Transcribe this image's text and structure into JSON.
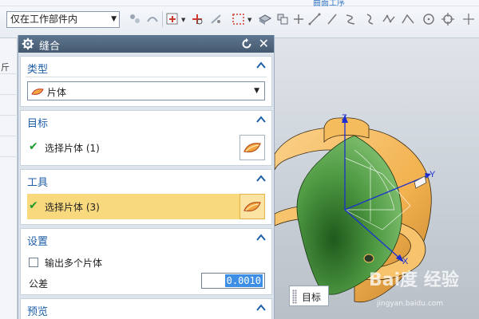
{
  "toolbar": {
    "ribbon_label": "曲面工序",
    "filter_value": "仅在工作部件内"
  },
  "left_strip": {
    "letter": "斤"
  },
  "dialog": {
    "title": "缝合",
    "groups": {
      "type": {
        "title": "类型",
        "select_value": "片体"
      },
      "target": {
        "title": "目标",
        "selection": "选择片体 (1)"
      },
      "tool": {
        "title": "工具",
        "selection": "选择片体 (3)"
      },
      "settings": {
        "title": "设置",
        "output_multiple_label": "输出多个片体",
        "output_multiple_checked": false,
        "tolerance_label": "公差",
        "tolerance_value": "0.0010"
      },
      "preview": {
        "title": "预览"
      }
    }
  },
  "viewport": {
    "tooltip": "目标",
    "axis_labels": {
      "z": "Z",
      "y": "Y",
      "x": "X"
    },
    "watermark": "Bai度 经验",
    "watermark_url": "jingyan.baidu.com"
  },
  "colors": {
    "title_bar": "#4f667d",
    "group_title": "#1f5fa8",
    "active_row": "#f9d97d",
    "surface_orange": "#f2b24f",
    "surface_green": "#5aa54c"
  }
}
